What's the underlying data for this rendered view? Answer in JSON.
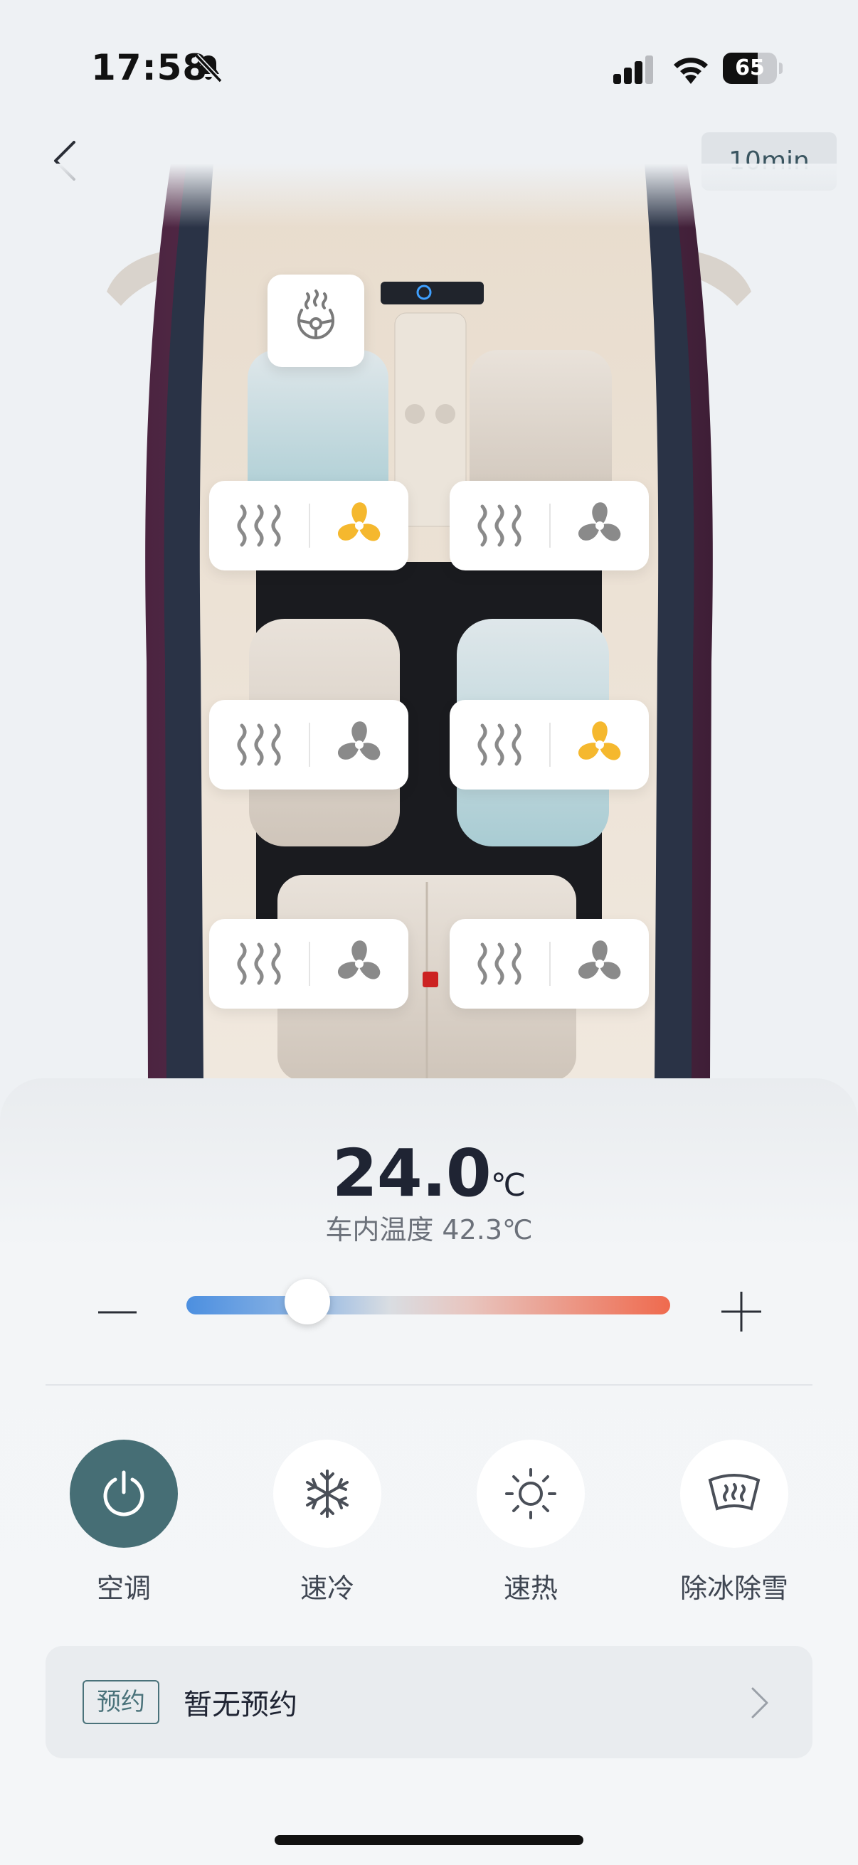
{
  "status_bar": {
    "time": "17:58",
    "battery": "65",
    "battery_level": 0.65
  },
  "header": {
    "timer": "10min"
  },
  "seats": [
    {
      "id": "front-left",
      "heat_on": false,
      "fan_on": true
    },
    {
      "id": "front-right",
      "heat_on": false,
      "fan_on": false
    },
    {
      "id": "middle-left",
      "heat_on": false,
      "fan_on": false
    },
    {
      "id": "middle-right",
      "heat_on": false,
      "fan_on": true
    },
    {
      "id": "rear-left",
      "heat_on": false,
      "fan_on": false
    },
    {
      "id": "rear-right",
      "heat_on": false,
      "fan_on": false
    }
  ],
  "climate": {
    "set_temp": "24.0",
    "unit": "℃",
    "cabin_temp_label": "车内温度 42.3℃",
    "slider_position": 0.25
  },
  "modes": [
    {
      "label": "空调",
      "icon": "power-icon",
      "active": true
    },
    {
      "label": "速冷",
      "icon": "snowflake-icon",
      "active": false
    },
    {
      "label": "速热",
      "icon": "sun-icon",
      "active": false
    },
    {
      "label": "除冰除雪",
      "icon": "defrost-icon",
      "active": false
    }
  ],
  "schedule": {
    "tag": "预约",
    "text": "暂无预约"
  },
  "colors": {
    "accent": "#466e75",
    "fan_active": "#f5b82e",
    "fan_inactive": "#8a8a8a"
  }
}
